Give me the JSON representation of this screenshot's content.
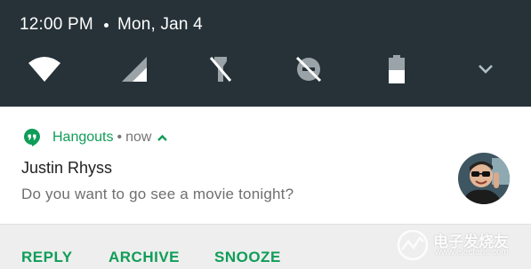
{
  "status_bar": {
    "time": "12:00 PM",
    "date": "Mon, Jan 4"
  },
  "quick_settings": {
    "tiles": [
      {
        "icon": "wifi-icon"
      },
      {
        "icon": "cellular-signal-icon"
      },
      {
        "icon": "flashlight-off-icon"
      },
      {
        "icon": "do-not-disturb-off-icon"
      },
      {
        "icon": "battery-icon",
        "level": 0.5
      }
    ],
    "expand_icon": "chevron-down-icon"
  },
  "notification": {
    "app_icon": "hangouts-icon",
    "app_name": "Hangouts",
    "separator": "•",
    "time": "now",
    "expanded_icon": "chevron-up-icon",
    "title": "Justin Rhyss",
    "text": "Do you want to go see a movie tonight?",
    "avatar": "contact-avatar"
  },
  "actions": [
    {
      "label": "REPLY"
    },
    {
      "label": "ARCHIVE"
    },
    {
      "label": "SNOOZE"
    }
  ],
  "watermark": {
    "text": "电子发烧友",
    "url_text": "www.elecfans.com"
  },
  "colors": {
    "shade_background": "#263238",
    "accent": "#0f9d58",
    "action_bar": "#eeeeee"
  }
}
